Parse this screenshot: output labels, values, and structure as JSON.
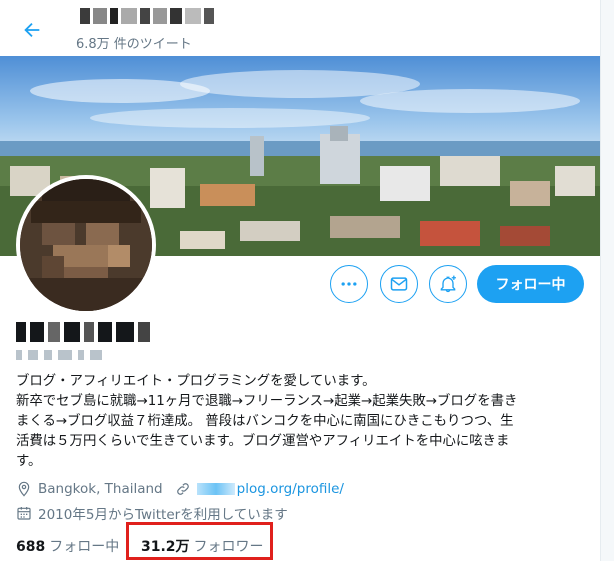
{
  "header": {
    "display_name_redacted": "",
    "tweet_count": "6.8万 件のツイート"
  },
  "actions": {
    "follow_label": "フォロー中"
  },
  "profile": {
    "bio_lines": [
      "ブログ・アフィリエイト・プログラミングを愛しています。",
      "新卒でセブ島に就職→11ヶ月で退職→フリーランス→起業→起業失敗→ブログを書き",
      "まくる→ブログ収益７桁達成。 普段はバンコクを中心に南国にひきこもりつつ、生",
      "活費は５万円くらいで生きています。ブログ運営やアフィリエイトを中心に呟きま",
      "す。"
    ],
    "location": "Bangkok, Thailand",
    "url_visible": "plog.org/profile/",
    "joined": "2010年5月からTwitterを利用しています"
  },
  "stats": {
    "following_count": "688",
    "following_label": "フォロー中",
    "followers_count": "31.2万",
    "followers_label": "フォロワー"
  },
  "icons": {
    "back": "arrow-left-icon",
    "more": "more-dots-icon",
    "message": "envelope-icon",
    "notify": "bell-plus-icon",
    "location": "location-pin-icon",
    "link": "link-icon",
    "calendar": "calendar-icon"
  },
  "colors": {
    "accent": "#1da1f2",
    "link": "#1b95e0",
    "secondary_text": "#657786",
    "highlight": "#e0201c"
  }
}
